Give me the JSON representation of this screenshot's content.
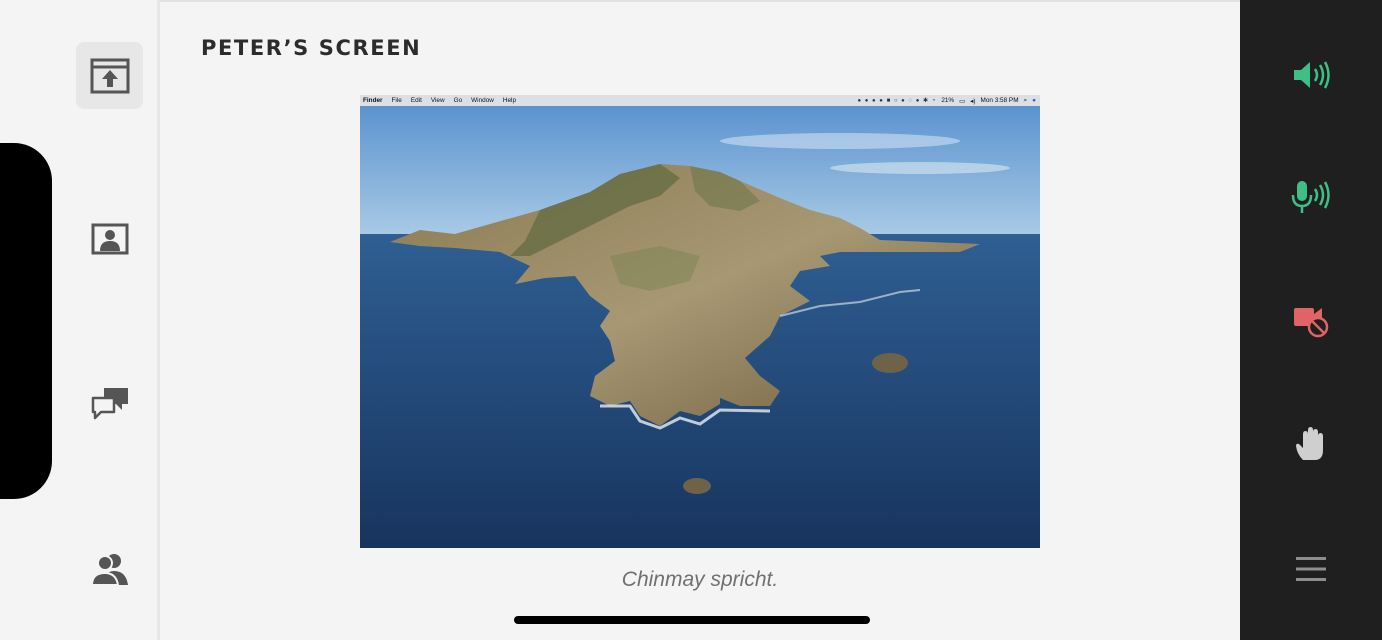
{
  "main": {
    "title": "PETER’S SCREEN",
    "caption": "Chinmay spricht."
  },
  "shared_screen": {
    "menubar": {
      "items": [
        "Finder",
        "File",
        "Edit",
        "View",
        "Go",
        "Window",
        "Help"
      ],
      "battery": "21%",
      "clock": "Mon 3:58 PM"
    }
  },
  "sidebar": {
    "items": [
      "share-screen",
      "video",
      "chat",
      "attendees"
    ]
  },
  "controls": {
    "items": [
      "speaker",
      "microphone",
      "camera-off",
      "raise-hand",
      "menu"
    ]
  },
  "colors": {
    "active_green": "#3fbf86",
    "alert_red": "#e06366",
    "icon_gray": "#555555",
    "panel_dark": "#1f1f1f"
  }
}
